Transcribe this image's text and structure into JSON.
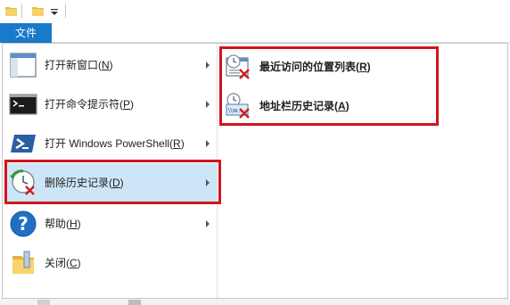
{
  "quick_access": {
    "icons": [
      "folder-icon",
      "folder-icon",
      "customize-toolbar-icon"
    ]
  },
  "ribbon": {
    "file_tab_label": "文件"
  },
  "left_menu": {
    "items": [
      {
        "name": "open-new-window",
        "icon": "window-icon",
        "label": "打开新窗口(",
        "key": "N",
        "close": ")"
      },
      {
        "name": "open-command-prompt",
        "icon": "command-prompt-icon",
        "label": "打开命令提示符(",
        "key": "P",
        "close": ")"
      },
      {
        "name": "open-powershell",
        "icon": "powershell-icon",
        "label": "打开 Windows PowerShell(",
        "key": "R",
        "close": ")"
      },
      {
        "name": "delete-history",
        "icon": "delete-history-icon",
        "label": "删除历史记录(",
        "key": "D",
        "close": ")"
      },
      {
        "name": "help",
        "icon": "help-icon",
        "label": "帮助(",
        "key": "H",
        "close": ")"
      },
      {
        "name": "close",
        "icon": "close-folder-icon",
        "label": "关闭(",
        "key": "C",
        "close": ")"
      }
    ]
  },
  "sub_menu": {
    "items": [
      {
        "name": "recent-locations",
        "icon": "recent-locations-clear-icon",
        "label": "最近访问的位置列表(",
        "key": "R",
        "close": ")"
      },
      {
        "name": "address-bar-history",
        "icon": "address-history-clear-icon",
        "label": "地址栏历史记录(",
        "key": "A",
        "close": ")"
      }
    ]
  },
  "colors": {
    "accent": "#1979ca",
    "highlight_box": "#d1151c",
    "selected_item": "#cde6f7"
  }
}
